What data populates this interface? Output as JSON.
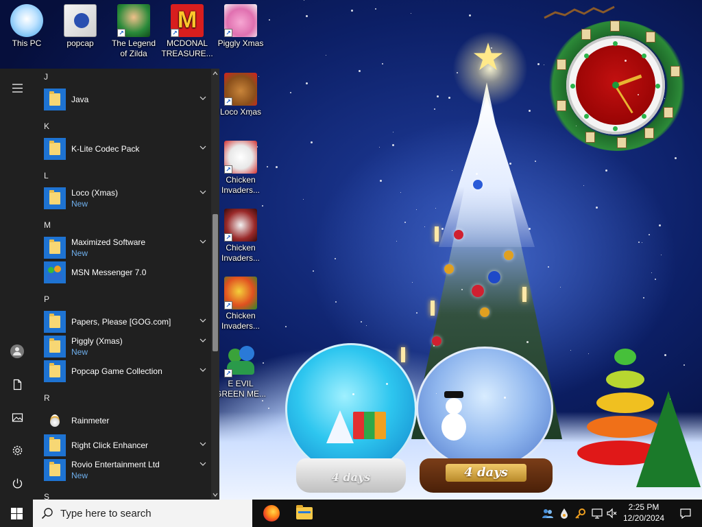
{
  "desktop": {
    "icons": [
      {
        "label": "This PC",
        "icon": "monitor-icon",
        "shortcut": false
      },
      {
        "label": "popcap",
        "icon": "folder-icon",
        "shortcut": false
      },
      {
        "label": "The Legend of Zilda",
        "icon": "game-hero-icon",
        "shortcut": true
      },
      {
        "label": "MCDONAL TREASURE...",
        "icon": "mcdonalds-icon",
        "shortcut": true
      },
      {
        "label": "Piggly Xmas",
        "icon": "pig-icon",
        "shortcut": true
      },
      {
        "label": "Loco Xmas",
        "icon": "bear-icon",
        "shortcut": true
      },
      {
        "label": "Chicken Invaders...",
        "icon": "chicken-icon",
        "shortcut": true
      },
      {
        "label": "Chicken Invaders...",
        "icon": "chicken-ship-icon",
        "shortcut": true
      },
      {
        "label": "Chicken Invaders...",
        "icon": "chicken-egg-icon",
        "shortcut": true
      },
      {
        "label": "E EVIL GREEN ME...",
        "icon": "msn-people-icon",
        "shortcut": true
      }
    ]
  },
  "wallpaper": {
    "globe_left_label": "4 days",
    "globe_right_label": "4 days"
  },
  "start_menu": {
    "rail": [
      "hamburger-icon",
      "user-icon",
      "documents-icon",
      "pictures-icon",
      "settings-icon",
      "power-icon"
    ],
    "sections": [
      {
        "letter": "J"
      },
      {
        "letter": "K"
      },
      {
        "letter": "L"
      },
      {
        "letter": "M"
      },
      {
        "letter": "P"
      },
      {
        "letter": "R"
      },
      {
        "letter": "S"
      }
    ],
    "apps": [
      {
        "name": "Java",
        "sub": "",
        "expandable": true
      },
      {
        "name": "K-Lite Codec Pack",
        "sub": "",
        "expandable": true
      },
      {
        "name": "Loco (Xmas)",
        "sub": "New",
        "expandable": true
      },
      {
        "name": "Maximized Software",
        "sub": "New",
        "expandable": true
      },
      {
        "name": "MSN Messenger 7.0",
        "sub": "",
        "expandable": false
      },
      {
        "name": "Papers, Please [GOG.com]",
        "sub": "",
        "expandable": true
      },
      {
        "name": "Piggly (Xmas)",
        "sub": "New",
        "expandable": true
      },
      {
        "name": "Popcap Game Collection",
        "sub": "",
        "expandable": true
      },
      {
        "name": "Rainmeter",
        "sub": "",
        "expandable": false
      },
      {
        "name": "Right Click Enhancer",
        "sub": "",
        "expandable": true
      },
      {
        "name": "Rovio Entertainment Ltd",
        "sub": "New",
        "expandable": true
      }
    ]
  },
  "taskbar": {
    "search_placeholder": "Type here to search",
    "pinned": [
      "firefox-icon",
      "file-explorer-icon"
    ],
    "tray": [
      "network-people-icon",
      "water-drop-icon",
      "key-icon",
      "network-icon",
      "volume-muted-icon"
    ],
    "time": "2:25 PM",
    "date": "12/20/2024"
  },
  "colors": {
    "start_bg": "#202020",
    "tile_blue": "#1e73d2",
    "new_label": "#6fb0ee",
    "taskbar_bg": "#101010"
  }
}
